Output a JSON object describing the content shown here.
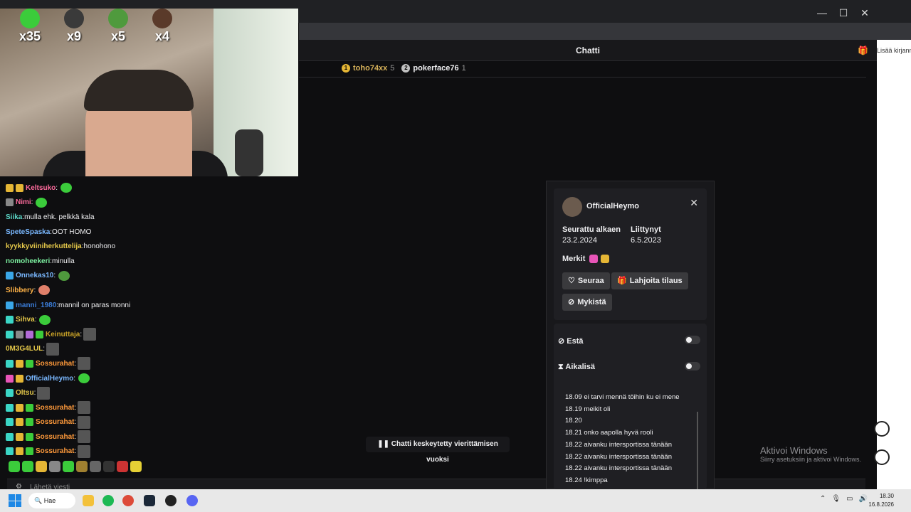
{
  "window": {
    "min": "—",
    "max": "☐",
    "close": "✕"
  },
  "header": {
    "title": "Chatti",
    "right_label": "Lisää kirjanmerkit"
  },
  "leaderboard": [
    {
      "name": "toho74xx",
      "count": "5",
      "color": "#e5b635"
    },
    {
      "name": "pokerface76",
      "count": "1",
      "color": "#c0c0c0"
    }
  ],
  "webcam_counters": [
    {
      "count": "x35",
      "color": "#3bcc3b"
    },
    {
      "count": "x9",
      "color": "#3a3a3a"
    },
    {
      "count": "x5",
      "color": "#4f9a3d"
    },
    {
      "count": "x4",
      "color": "#5a3a2a"
    }
  ],
  "chat": [
    {
      "badges": [
        "#e5b635",
        "#e5b635"
      ],
      "user": "Keltsuko",
      "color": "#ff6b9d",
      "text": "",
      "emote": "#3bcc3b"
    },
    {
      "badges": [
        "#888"
      ],
      "user": "Nimi",
      "color": "#ff6b9d",
      "text": "",
      "emote": "#3bcc3b"
    },
    {
      "badges": [],
      "user": "Siika",
      "color": "#5bd6c6",
      "text": "mulla ehk. pelkkä kala",
      "emote": ""
    },
    {
      "badges": [],
      "user": "SpeteSpaska",
      "color": "#7ab8ff",
      "text": "OOT HOMO",
      "emote": ""
    },
    {
      "badges": [],
      "user": "kyykkyviiniherkuttelija",
      "color": "#e6c94a",
      "text": "honohono",
      "emote": ""
    },
    {
      "badges": [],
      "user": "nomoheekeri",
      "color": "#7cf0a0",
      "text": "minulla",
      "emote": ""
    },
    {
      "badges": [
        "#3aa7e8"
      ],
      "user": "Onnekas10",
      "color": "#7ab8ff",
      "text": "",
      "emote": "#4f9a3d"
    },
    {
      "badges": [],
      "user": "Slibbery",
      "color": "#ffb347",
      "text": "",
      "emote": "#e0806a"
    },
    {
      "badges": [
        "#3aa7e8"
      ],
      "user": "manni_1980",
      "color": "#3a7bd5",
      "text": "mannil on paras monni",
      "emote": ""
    },
    {
      "badges": [
        "#3bd6c6"
      ],
      "user": "Sihva",
      "color": "#e6c94a",
      "text": "",
      "emote": "#3bcc3b"
    },
    {
      "badges": [
        "#3bd6c6",
        "#888",
        "#b26bd6",
        "#3bcc3b"
      ],
      "user": "Keinuttaja",
      "color": "#c9a227",
      "text": "",
      "emote": "#555"
    },
    {
      "badges": [],
      "user": "0M3G4LUL",
      "color": "#e6c94a",
      "text": "",
      "emote": "#555"
    },
    {
      "badges": [
        "#3bd6c6",
        "#e5b635",
        "#3bcc3b"
      ],
      "user": "Sossurahat",
      "color": "#ff9a3b",
      "text": "",
      "emote": "#555"
    },
    {
      "badges": [
        "#e855b8",
        "#e5b635"
      ],
      "user": "OfficialHeymo",
      "color": "#7ab8ff",
      "text": "",
      "emote": "#3bcc3b"
    },
    {
      "badges": [
        "#3bd6c6"
      ],
      "user": "Oltsu",
      "color": "#e6c94a",
      "text": "",
      "emote": "#555"
    },
    {
      "badges": [
        "#3bd6c6",
        "#e5b635",
        "#3bcc3b"
      ],
      "user": "Sossurahat",
      "color": "#ff9a3b",
      "text": "",
      "emote": "#555"
    },
    {
      "badges": [
        "#3bd6c6",
        "#e5b635",
        "#3bcc3b"
      ],
      "user": "Sossurahat",
      "color": "#ff9a3b",
      "text": "",
      "emote": "#555"
    },
    {
      "badges": [
        "#3bd6c6",
        "#e5b635",
        "#3bcc3b"
      ],
      "user": "Sossurahat",
      "color": "#ff9a3b",
      "text": "",
      "emote": "#555"
    },
    {
      "badges": [
        "#3bd6c6",
        "#e5b635",
        "#3bcc3b"
      ],
      "user": "Sossurahat",
      "color": "#ff9a3b",
      "text": "",
      "emote": "#555"
    }
  ],
  "emote_bar": [
    "#3bcc3b",
    "#3bcc3b",
    "#e5b635",
    "#888",
    "#3bcc3b",
    "#a08030",
    "#666",
    "#333",
    "#cc3333",
    "#e5d035"
  ],
  "paused": "Chatti keskeytetty vierittämisen vuoksi",
  "input": {
    "placeholder": "Lähetä viesti"
  },
  "watermark": {
    "title": "Aktivoi Windows",
    "subtitle": "Siirry asetuksiin ja aktivoi Windows."
  },
  "card": {
    "name": "OfficialHeymo",
    "followed_label": "Seurattu alkaen",
    "followed_value": "23.2.2024",
    "joined_label": "Liittynyt",
    "joined_value": "6.5.2023",
    "badges_label": "Merkit",
    "badges": [
      "#e855b8",
      "#e5b635"
    ],
    "follow": "Seuraa",
    "gift": "Lahjoita tilaus",
    "mute": "Mykistä",
    "ban": "Estä",
    "timeout": "Aikalisä",
    "history": [
      "18.09 ei tarvi mennä töihin ku ei mene",
      "18.19 meikit oli",
      "18.20",
      "18.21 onko aapolla hyvä rooli",
      "18.22 aivanku intersportissa tänään",
      "18.22 aivanku intersportissa tänään",
      "18.22 aivanku intersportissa tänään",
      "18.24 !kimppa"
    ]
  },
  "taskbar": {
    "search": "Hae",
    "time": "18.30",
    "date": "16.8.2026"
  }
}
